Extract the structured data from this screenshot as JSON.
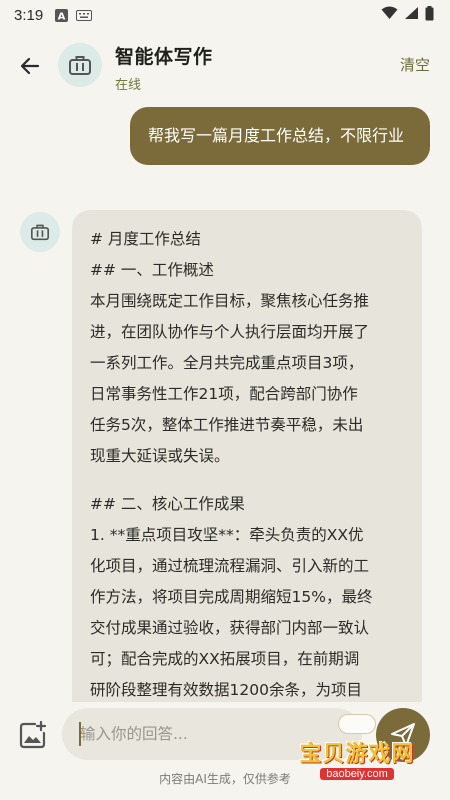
{
  "status_bar": {
    "time": "3:19",
    "icons": [
      "notification-a-icon",
      "keyboard-icon",
      "wifi-icon",
      "signal-icon",
      "battery-icon"
    ]
  },
  "header": {
    "title": "智能体写作",
    "subtitle": "在线",
    "clear_label": "清空",
    "avatar_icon": "briefcase-icon"
  },
  "messages": {
    "user": "帮我写一篇月度工作总结，不限行业",
    "ai_lines": [
      "# 月度工作总结",
      "## 一、工作概述",
      "本月围绕既定工作目标，聚焦核心任务推",
      "进，在团队协作与个人执行层面均开展了",
      "一系列工作。全月共完成重点项目3项，",
      "日常事务性工作21项，配合跨部门协作",
      "任务5次，整体工作推进节奏平稳，未出",
      "现重大延误或失误。",
      "",
      "## 二、核心工作成果",
      "1. **重点项目攻坚**：牵头负责的XX优",
      "化项目，通过梳理流程漏洞、引入新的工",
      "作方法，将项目完成周期缩短15%，最终",
      "交付成果通过验收，获得部门内部一致认",
      "可；配合完成的XX拓展项目，在前期调",
      "研阶段整理有效数据1200余条，为项目"
    ]
  },
  "input": {
    "placeholder": "输入你的回答..."
  },
  "footer": {
    "disclaimer": "内容由AI生成，仅供参考"
  },
  "watermark": {
    "text": "宝贝游戏网",
    "url": "baobeiy.com"
  },
  "colors": {
    "accent": "#7c6b3a",
    "online": "#6d7a38",
    "avatar_bg": "#dcebe7",
    "ai_bubble": "#e7e4dc",
    "background": "#f5f4ef"
  }
}
